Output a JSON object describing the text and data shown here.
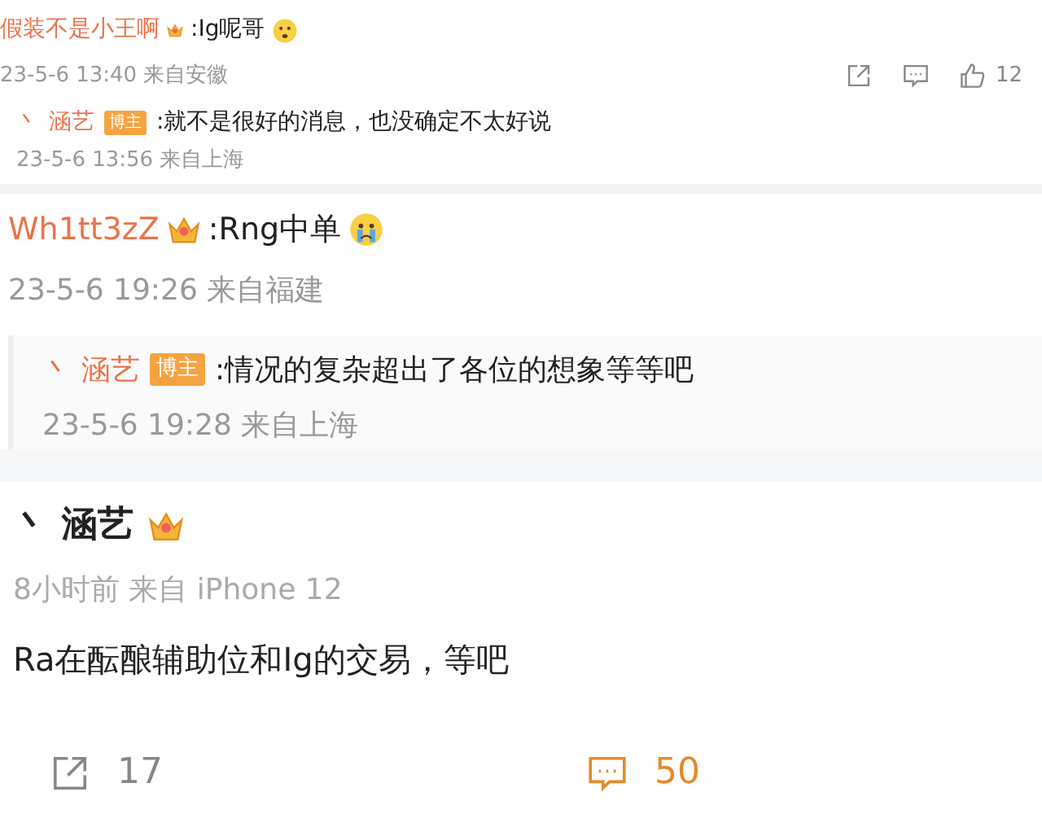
{
  "comments": [
    {
      "author": "假装不是小王啊",
      "text": ":Ig呢哥",
      "time": "23-5-6 13:40 来自安徽",
      "like_count": "12",
      "replies": [
        {
          "prefix": "丶",
          "author": "涵艺",
          "badge": "博主",
          "text": ":就不是很好的消息，也没确定不太好说",
          "time": "23-5-6 13:56 来自上海"
        }
      ]
    },
    {
      "author": "Wh1tt3zZ",
      "text": ":Rng中单",
      "time": "23-5-6 19:26 来自福建",
      "replies": [
        {
          "prefix": "丶",
          "author": "涵艺",
          "badge": "博主",
          "text": ":情况的复杂超出了各位的想象等等吧",
          "time": "23-5-6 19:28 来自上海"
        }
      ]
    }
  ],
  "post": {
    "prefix": "丶",
    "author": "涵艺",
    "time": "8小时前 来自 iPhone 12",
    "text": "Ra在酝酿辅助位和Ig的交易，等吧",
    "actions": [
      {
        "kind": "repost",
        "count": "17",
        "active": false
      },
      {
        "kind": "comment",
        "count": "50",
        "active": true
      }
    ]
  }
}
